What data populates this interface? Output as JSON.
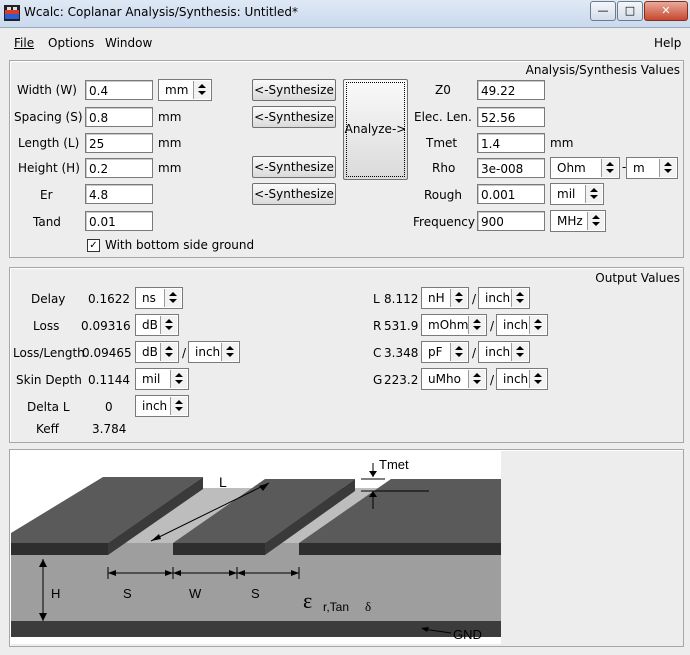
{
  "window": {
    "title": "Wcalc: Coplanar Analysis/Synthesis: Untitled*"
  },
  "menu": {
    "file": "File",
    "options": "Options",
    "window": "Window",
    "help": "Help"
  },
  "analysis": {
    "group_title": "Analysis/Synthesis Values",
    "width": {
      "label": "Width (W)",
      "value": "0.4",
      "unit": "mm"
    },
    "spacing": {
      "label": "Spacing (S)",
      "value": "0.8",
      "unit": "mm"
    },
    "length": {
      "label": "Length (L)",
      "value": "25",
      "unit": "mm"
    },
    "height": {
      "label": "Height (H)",
      "value": "0.2",
      "unit": "mm"
    },
    "er": {
      "label": "Er",
      "value": "4.8"
    },
    "tand": {
      "label": "Tand",
      "value": "0.01"
    },
    "bottom_ground": {
      "label": "With bottom side ground",
      "checked": true
    },
    "synthesize_label": "<-Synthesize",
    "analyze_label": "Analyze->",
    "z0": {
      "label": "Z0",
      "value": "49.22"
    },
    "elec_len": {
      "label": "Elec. Len.",
      "value": "52.56"
    },
    "tmet": {
      "label": "Tmet",
      "value": "1.4",
      "unit": "mm"
    },
    "rho": {
      "label": "Rho",
      "value": "3e-008",
      "unit1": "Ohm",
      "dash": "-",
      "unit2": "m"
    },
    "rough": {
      "label": "Rough",
      "value": "0.001",
      "unit": "mil"
    },
    "frequency": {
      "label": "Frequency",
      "value": "900",
      "unit": "MHz"
    }
  },
  "output": {
    "group_title": "Output Values",
    "delay": {
      "label": "Delay",
      "value": "0.1622",
      "unit": "ns"
    },
    "loss": {
      "label": "Loss",
      "value": "0.09316",
      "unit": "dB"
    },
    "loss_length": {
      "label": "Loss/Length",
      "value": "0.09465",
      "unit1": "dB",
      "slash": "/",
      "unit2": "inch"
    },
    "skin_depth": {
      "label": "Skin Depth",
      "value": "0.1144",
      "unit": "mil"
    },
    "delta_l": {
      "label": "Delta L",
      "value": "0",
      "unit": "inch"
    },
    "keff": {
      "label": "Keff",
      "value": "3.784"
    },
    "L": {
      "label": "L",
      "value": "8.112",
      "unit1": "nH",
      "unit2": "inch"
    },
    "R": {
      "label": "R",
      "value": "531.9",
      "unit1": "mOhm",
      "unit2": "inch"
    },
    "C": {
      "label": "C",
      "value": "3.348",
      "unit1": "pF",
      "unit2": "inch"
    },
    "G": {
      "label": "G",
      "value": "223.2",
      "unit1": "uMho",
      "unit2": "inch"
    },
    "slash": "/"
  },
  "diagram": {
    "tmet": "Tmet",
    "L": "L",
    "H": "H",
    "S": "S",
    "W": "W",
    "GND": "GND",
    "epsilon": "ε",
    "sub": "r,Tan",
    "delta": "δ"
  }
}
